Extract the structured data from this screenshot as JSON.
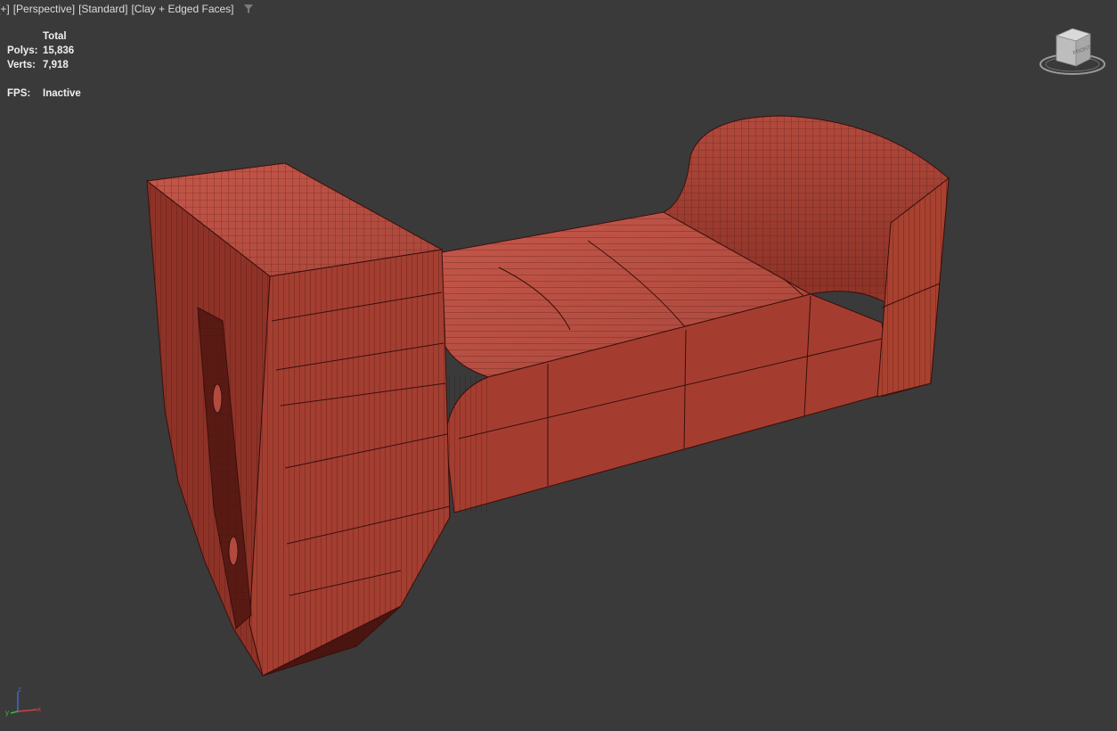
{
  "viewport": {
    "label": {
      "plus": "[+]",
      "view": "[Perspective]",
      "shading_style": "[Standard]",
      "display_mode": "[Clay + Edged Faces]"
    },
    "stats": {
      "header": "Total",
      "polys_label": "Polys:",
      "polys_value": "15,836",
      "verts_label": "Verts:",
      "verts_value": "7,918",
      "fps_label": "FPS:",
      "fps_value": "Inactive"
    },
    "viewcube": {
      "face": "FRONT",
      "icon": "viewcube-icon"
    },
    "axis": {
      "x": "x",
      "y": "y",
      "z": "z"
    }
  },
  "colors": {
    "background": "#3a3a3a",
    "clay_light": "#b5483a",
    "clay_mid": "#9c3a2e",
    "clay_dark": "#7a2a22",
    "clay_shadow": "#4a1410",
    "edge": "#3a0f0b"
  }
}
